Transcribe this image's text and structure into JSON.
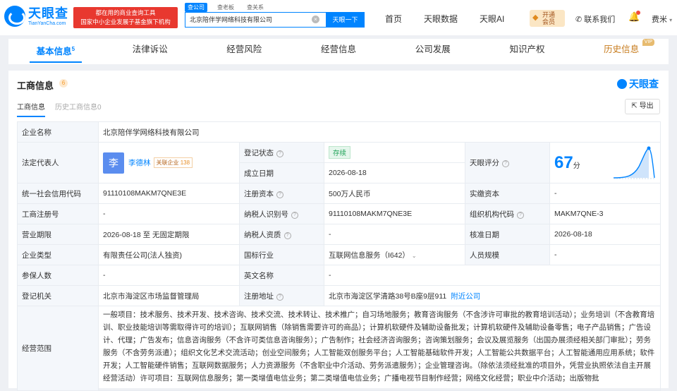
{
  "brand": {
    "name": "天眼查",
    "url": "TianYanCha.com",
    "promo_line1": "都在用的商业查询工具",
    "promo_line2": "国家中小企业发展子基金旗下机构"
  },
  "search": {
    "tabs": [
      "查公司",
      "查老板",
      "查关系"
    ],
    "value": "北京陪伴学网络科技有限公司",
    "button": "天眼一下"
  },
  "nav": {
    "items": [
      "首页",
      "天眼数据",
      "天眼AI"
    ],
    "vip_line1": "开通",
    "vip_line2": "会员",
    "contact": "联系我们",
    "user": "费米"
  },
  "tabs": [
    {
      "label": "基本信息",
      "count": "5"
    },
    {
      "label": "法律诉讼"
    },
    {
      "label": "经营风险"
    },
    {
      "label": "经营信息"
    },
    {
      "label": "公司发展"
    },
    {
      "label": "知识产权"
    },
    {
      "label": "历史信息",
      "tag": "VIP"
    }
  ],
  "card": {
    "title": "工商信息",
    "dot": "6",
    "brand": "天眼查",
    "subtabs": [
      "工商信息",
      "历史工商信息0"
    ],
    "export": "导出"
  },
  "info": {
    "company_name_label": "企业名称",
    "company_name": "北京陪伴学网络科技有限公司",
    "legal_rep_label": "法定代表人",
    "legal_rep_avatar": "李",
    "legal_rep": "李德林",
    "related_label": "关联企业",
    "related_count": "138",
    "reg_status_label": "登记状态",
    "reg_status": "存续",
    "established_label": "成立日期",
    "established": "2026-08-18",
    "score_label": "天眼评分",
    "score": "67",
    "score_unit": "分",
    "credit_code_label": "统一社会信用代码",
    "credit_code": "91110108MAKM7QNE3E",
    "reg_capital_label": "注册资本",
    "reg_capital": "500万人民币",
    "paid_capital_label": "实缴资本",
    "paid_capital": "-",
    "reg_no_label": "工商注册号",
    "reg_no": "-",
    "taxpayer_id_label": "纳税人识别号",
    "taxpayer_id": "91110108MAKM7QNE3E",
    "org_code_label": "组织机构代码",
    "org_code": "MAKM7QNE-3",
    "term_label": "营业期限",
    "term": "2026-08-18 至 无固定期限",
    "taxpayer_qual_label": "纳税人资质",
    "taxpayer_qual": "-",
    "approve_date_label": "核准日期",
    "approve_date": "2026-08-18",
    "type_label": "企业类型",
    "type": "有限责任公司(法人独资)",
    "industry_label": "国标行业",
    "industry": "互联网信息服务（I642）",
    "staff_label": "人员规模",
    "staff": "-",
    "insured_label": "参保人数",
    "insured": "-",
    "en_name_label": "英文名称",
    "en_name": "-",
    "authority_label": "登记机关",
    "authority": "北京市海淀区市场监督管理局",
    "address_label": "注册地址",
    "address": "北京市海淀区学清路38号B座9层911",
    "nearby": "附近公司",
    "scope_label": "经营范围",
    "scope": "一般项目：技术服务、技术开发、技术咨询、技术交流、技术转让、技术推广；自习场地服务；教育咨询服务（不含涉许可审批的教育培训活动）；业务培训（不含教育培训、职业技能培训等需取得许可的培训）；互联网销售（除销售需要许可的商品）；计算机软硬件及辅助设备批发；计算机软硬件及辅助设备零售；电子产品销售；广告设计、代理；广告发布；信息咨询服务（不含许可类信息咨询服务）；广告制作；社会经济咨询服务；咨询策划服务；会议及展览服务（出国办展须经相关部门审批）；劳务服务（不含劳务派遣）；组织文化艺术交流活动；创业空间服务；人工智能双创服务平台；人工智能基础软件开发；人工智能公共数据平台；人工智能通用应用系统；软件开发；人工智能硬件销售；互联网数据服务；人力资源服务（不含职业中介活动、劳务派遣服务）；企业管理咨询。（除依法须经批准的项目外，凭营业执照依法自主开展经营活动）许可项目：互联网信息服务；第一类增值电信业务；第二类增值电信业务；广播电视节目制作经营；网络文化经营；职业中介活动；出版物批"
  }
}
